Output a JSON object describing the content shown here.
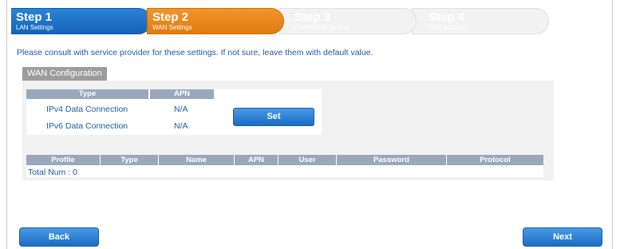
{
  "steps": [
    {
      "num": "Step 1",
      "sub": "LAN Settings"
    },
    {
      "num": "Step 2",
      "sub": "WAN Settings"
    },
    {
      "num": "Step 3",
      "sub": "Connection Setting"
    },
    {
      "num": "Step 4",
      "sub": "WiFi Settings"
    }
  ],
  "hint": "Please consult with service provider for these settings. If not sure, leave them with default value.",
  "wan": {
    "tab_label": "WAN Configuration",
    "columns": [
      "Type",
      "APN"
    ],
    "rows": [
      {
        "type": "IPv4 Data Connection",
        "apn": "N/A"
      },
      {
        "type": "IPv6 Data Connection",
        "apn": "N/A"
      }
    ],
    "set_label": "Set"
  },
  "profiles": {
    "columns": [
      "Profile",
      "Type",
      "Name",
      "APN",
      "User",
      "Password",
      "Protocol"
    ],
    "total": "Total Num : 0"
  },
  "nav": {
    "back": "Back",
    "next": "Next"
  },
  "colors": {
    "active_step": "#1464b8",
    "current_step": "#e07a10",
    "header": "#99a8bb",
    "text": "#1a5aa8"
  }
}
